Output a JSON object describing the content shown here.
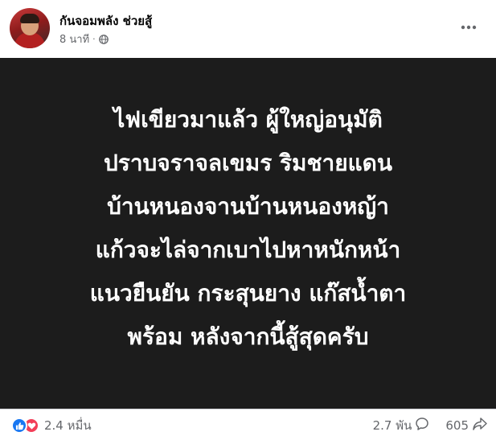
{
  "post": {
    "page_name": "กันจอมพลัง ช่วยสู้",
    "time": "8 นาที",
    "content_lines": [
      "ไฟเขียวมาแล้ว ผู้ใหญ่อนุมัติ",
      "ปราบจราจลเขมร ริมชายแดน",
      "บ้านหนองจานบ้านหนองหญ้า",
      "แก้วจะไล่จากเบาไปหาหนักหน้า",
      "แนวยืนยัน กระสุนยาง แก๊สน้ำตา",
      "พร้อม หลังจากนี้สู้สุดครับ"
    ],
    "reaction_count": "2.4 หมื่น",
    "comment_count": "2.7 พัน",
    "share_count": "605"
  },
  "icons": {
    "privacy": "globe-icon",
    "more": "more-options-icon",
    "like": "like-reaction-icon",
    "love": "love-reaction-icon",
    "comment": "comment-icon",
    "share": "share-icon"
  },
  "colors": {
    "content_background": "#1c1c1c",
    "content_text": "#ffffff",
    "like_blue": "#1877f2",
    "love_red": "#f33e58",
    "secondary_text": "#65676b"
  }
}
